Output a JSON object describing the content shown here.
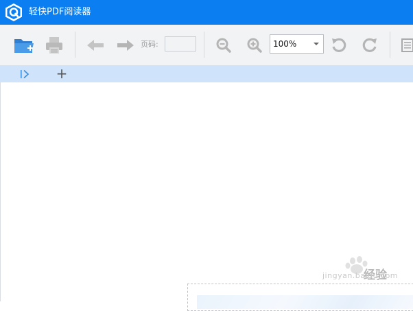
{
  "app": {
    "title": "轻快PDF阅读器",
    "accent_color": "#0b7ff2",
    "logo_icon": "q-hexagon-logo-icon"
  },
  "toolbar": {
    "open_icon": "folder-open-icon",
    "print_icon": "printer-icon",
    "back_icon": "arrow-left-icon",
    "forward_icon": "arrow-right-icon",
    "page_label": "页码:",
    "page_value": "",
    "zoom_out_icon": "zoom-out-icon",
    "zoom_in_icon": "zoom-in-icon",
    "zoom_value": "100%",
    "rotate_left_icon": "rotate-ccw-icon",
    "rotate_right_icon": "rotate-cw-icon",
    "document_icon": "document-icon"
  },
  "tabbar": {
    "sidebar_toggle_icon": "sidebar-toggle-icon",
    "add_tab_label": "+"
  },
  "watermark": {
    "brand_text": "经验",
    "url_text": "jingyan.baidu.com"
  }
}
